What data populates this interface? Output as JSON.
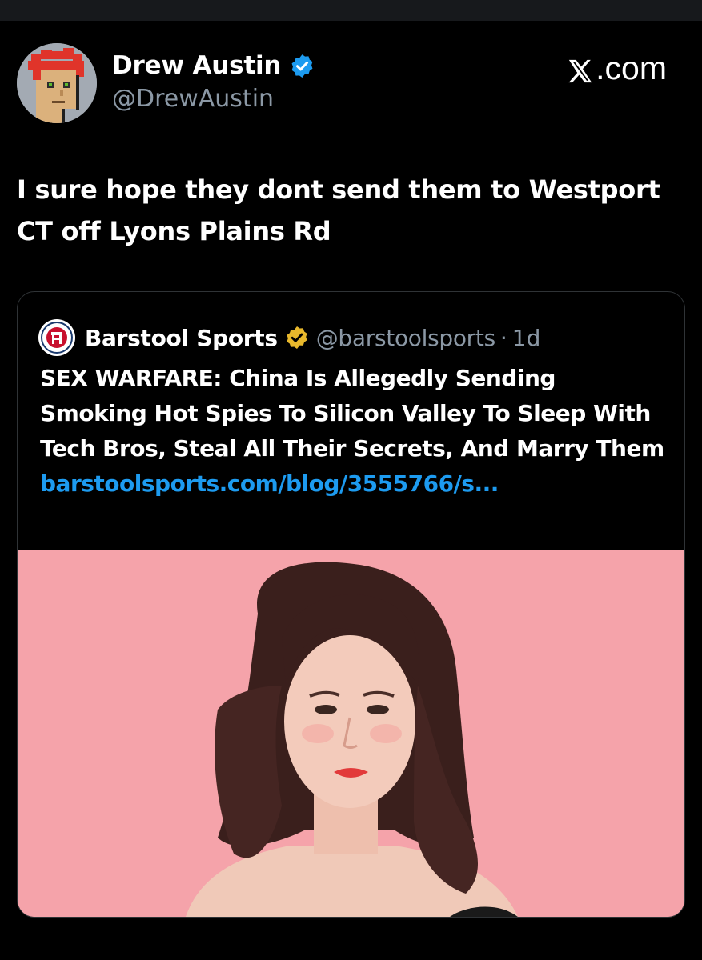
{
  "author": {
    "name": "Drew Austin",
    "handle": "@DrewAustin",
    "verified": true,
    "verified_color": "#1d9bf0"
  },
  "brand": {
    "label": ".com",
    "icon": "x-logo-icon"
  },
  "tweet": {
    "text": "I sure hope they dont send them to Westport CT off Lyons Plains Rd"
  },
  "quoted": {
    "name": "Barstool Sports",
    "handle": "@barstoolsports",
    "separator": "·",
    "time": "1d",
    "verified_color": "#e8b82c",
    "headline": "SEX WARFARE: China Is Allegedly Sending Smoking Hot Spies To Silicon Valley To Sleep With Tech Bros, Steal All Their Secrets, And Marry Them",
    "link": "barstoolsports.com/blog/3555766/s...",
    "link_color": "#1d9bf0",
    "image": {
      "icon": "woman-portrait-photo",
      "background": "#f5a3aa"
    }
  },
  "colors": {
    "background": "#000000",
    "primary_text": "#ffffff",
    "secondary_text": "#8b98a5"
  }
}
